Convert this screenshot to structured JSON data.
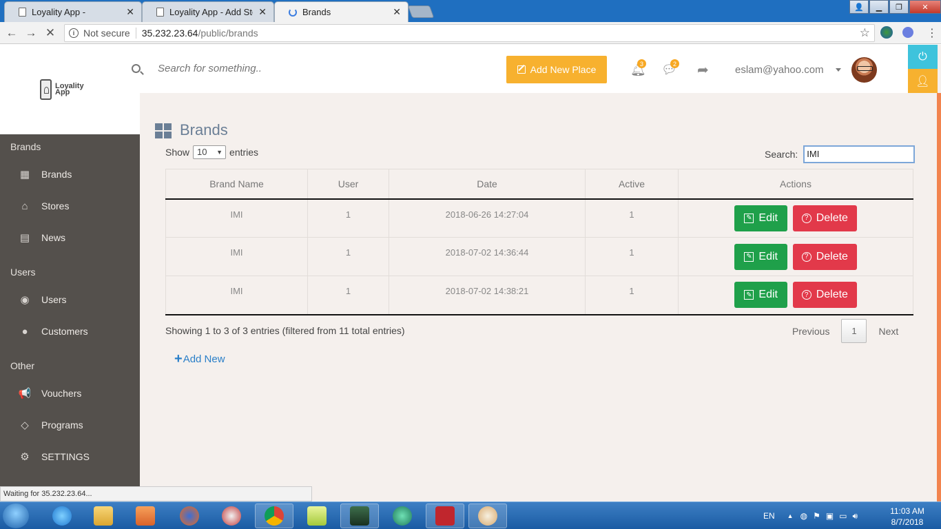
{
  "browser": {
    "tabs": [
      {
        "title": "Loyality App -"
      },
      {
        "title": "Loyality App - Add Stores"
      },
      {
        "title": "Brands"
      }
    ],
    "address": {
      "not_secure": "Not secure",
      "host": "35.232.23.64",
      "path": "/public/brands"
    },
    "status_text": "Waiting for 35.232.23.64..."
  },
  "app": {
    "logo_text": "Loyality App",
    "sidebar": {
      "sections": [
        "Brands",
        "Users",
        "Other"
      ],
      "items": [
        {
          "label": "Brands",
          "icon": "grid-icon"
        },
        {
          "label": "Stores",
          "icon": "home-icon"
        },
        {
          "label": "News",
          "icon": "newspaper-icon"
        },
        {
          "label": "Users",
          "icon": "user-circle-icon"
        },
        {
          "label": "Customers",
          "icon": "user-icon"
        },
        {
          "label": "Vouchers",
          "icon": "megaphone-icon"
        },
        {
          "label": "Programs",
          "icon": "diamond-icon"
        },
        {
          "label": "SETTINGS",
          "icon": "gear-icon"
        }
      ]
    },
    "topbar": {
      "search_placeholder": "Search for something..",
      "add_place_label": "Add New Place",
      "notifications_count": "3",
      "messages_count": "2",
      "user_email": "eslam@yahoo.com"
    },
    "page": {
      "title": "Brands",
      "show_label": "Show",
      "entries_value": "10",
      "entries_label": "entries",
      "search_label": "Search:",
      "search_value": "IMI",
      "columns": [
        "Brand Name",
        "User",
        "Date",
        "Active",
        "Actions"
      ],
      "rows": [
        {
          "brand": "IMI",
          "user": "1",
          "date": "2018-06-26 14:27:04",
          "active": "1"
        },
        {
          "brand": "IMI",
          "user": "1",
          "date": "2018-07-02 14:36:44",
          "active": "1"
        },
        {
          "brand": "IMI",
          "user": "1",
          "date": "2018-07-02 14:38:21",
          "active": "1"
        }
      ],
      "edit_label": "Edit",
      "delete_label": "Delete",
      "info": "Showing 1 to 3 of 3 entries (filtered from 11 total entries)",
      "pager": {
        "previous": "Previous",
        "page": "1",
        "next": "Next"
      },
      "add_new_label": "Add New"
    },
    "colors": {
      "accent": "#f7b12f",
      "sidebar": "#54504c",
      "edit": "#1fa04a",
      "delete": "#e2394a",
      "title": "#6b7f96"
    }
  },
  "taskbar": {
    "language": "EN",
    "time": "11:03 AM",
    "date": "8/7/2018"
  }
}
